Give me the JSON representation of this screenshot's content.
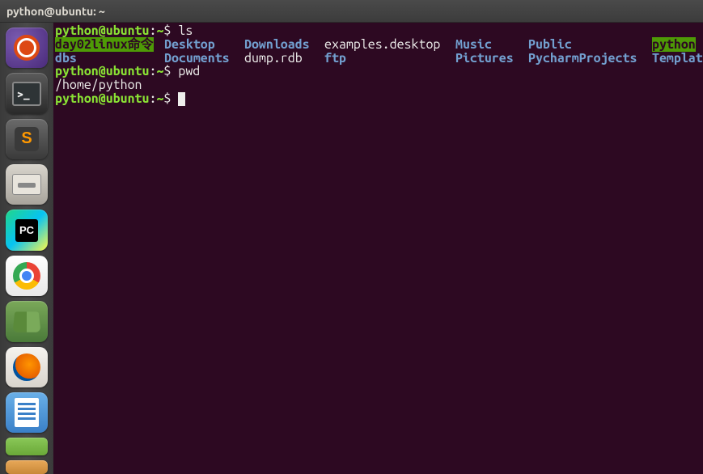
{
  "titlebar": {
    "title": "python@ubuntu: ~"
  },
  "launcher": {
    "items": [
      {
        "name": "ubuntu-dash"
      },
      {
        "name": "terminal"
      },
      {
        "name": "sublime-text"
      },
      {
        "name": "files"
      },
      {
        "name": "pycharm"
      },
      {
        "name": "chrome"
      },
      {
        "name": "document-reader"
      },
      {
        "name": "firefox"
      },
      {
        "name": "libreoffice-writer"
      },
      {
        "name": "spreadsheet"
      },
      {
        "name": "presentation"
      }
    ]
  },
  "terminal": {
    "prompt": {
      "user": "python@ubuntu",
      "sep": ":",
      "path": "~",
      "symbol": "$"
    },
    "lines": [
      {
        "type": "cmd",
        "command": "ls"
      },
      {
        "type": "ls",
        "row1": {
          "c1": {
            "text": "day02linux命令",
            "cls": "hl-green"
          },
          "c2": {
            "text": "Desktop",
            "cls": "dir"
          },
          "c3": {
            "text": "Downloads",
            "cls": "dir"
          },
          "c4": {
            "text": "examples.desktop",
            "cls": "file"
          },
          "c5": {
            "text": "Music",
            "cls": "dir"
          },
          "c6": {
            "text": "Public",
            "cls": "dir"
          },
          "c7": {
            "text": "python",
            "cls": "hl-green"
          }
        },
        "row2": {
          "c1": {
            "text": "dbs",
            "cls": "dir"
          },
          "c2": {
            "text": "Documents",
            "cls": "dir"
          },
          "c3": {
            "text": "dump.rdb",
            "cls": "file"
          },
          "c4": {
            "text": "ftp",
            "cls": "dir"
          },
          "c5": {
            "text": "Pictures",
            "cls": "dir"
          },
          "c6": {
            "text": "PycharmProjects",
            "cls": "dir"
          },
          "c7": {
            "text": "Templat",
            "cls": "dir"
          }
        }
      },
      {
        "type": "cmd",
        "command": "pwd"
      },
      {
        "type": "out",
        "text": "/home/python"
      },
      {
        "type": "cmd",
        "command": "",
        "cursor": true
      }
    ]
  }
}
